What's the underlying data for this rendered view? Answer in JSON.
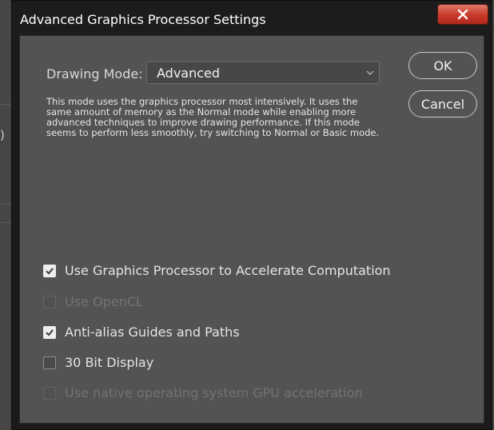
{
  "dialog": {
    "title": "Advanced Graphics Processor Settings",
    "close_icon": "close-icon"
  },
  "drawing_mode": {
    "label": "Drawing Mode:",
    "selected": "Advanced",
    "description": "This mode uses the graphics processor most intensively.  It uses the same amount of memory as the Normal mode while enabling more advanced techniques to improve drawing performance.  If this mode seems to perform less smoothly, try switching to Normal or Basic mode."
  },
  "buttons": {
    "ok": "OK",
    "cancel": "Cancel"
  },
  "options": [
    {
      "label": "Use Graphics Processor to Accelerate Computation",
      "checked": true,
      "enabled": true
    },
    {
      "label": "Use OpenCL",
      "checked": false,
      "enabled": false
    },
    {
      "label": "Anti-alias Guides and Paths",
      "checked": true,
      "enabled": true
    },
    {
      "label": "30 Bit Display",
      "checked": false,
      "enabled": true
    },
    {
      "label": "Use native operating system GPU acceleration",
      "checked": false,
      "enabled": false
    }
  ],
  "background": {
    "paren_text": ")"
  }
}
